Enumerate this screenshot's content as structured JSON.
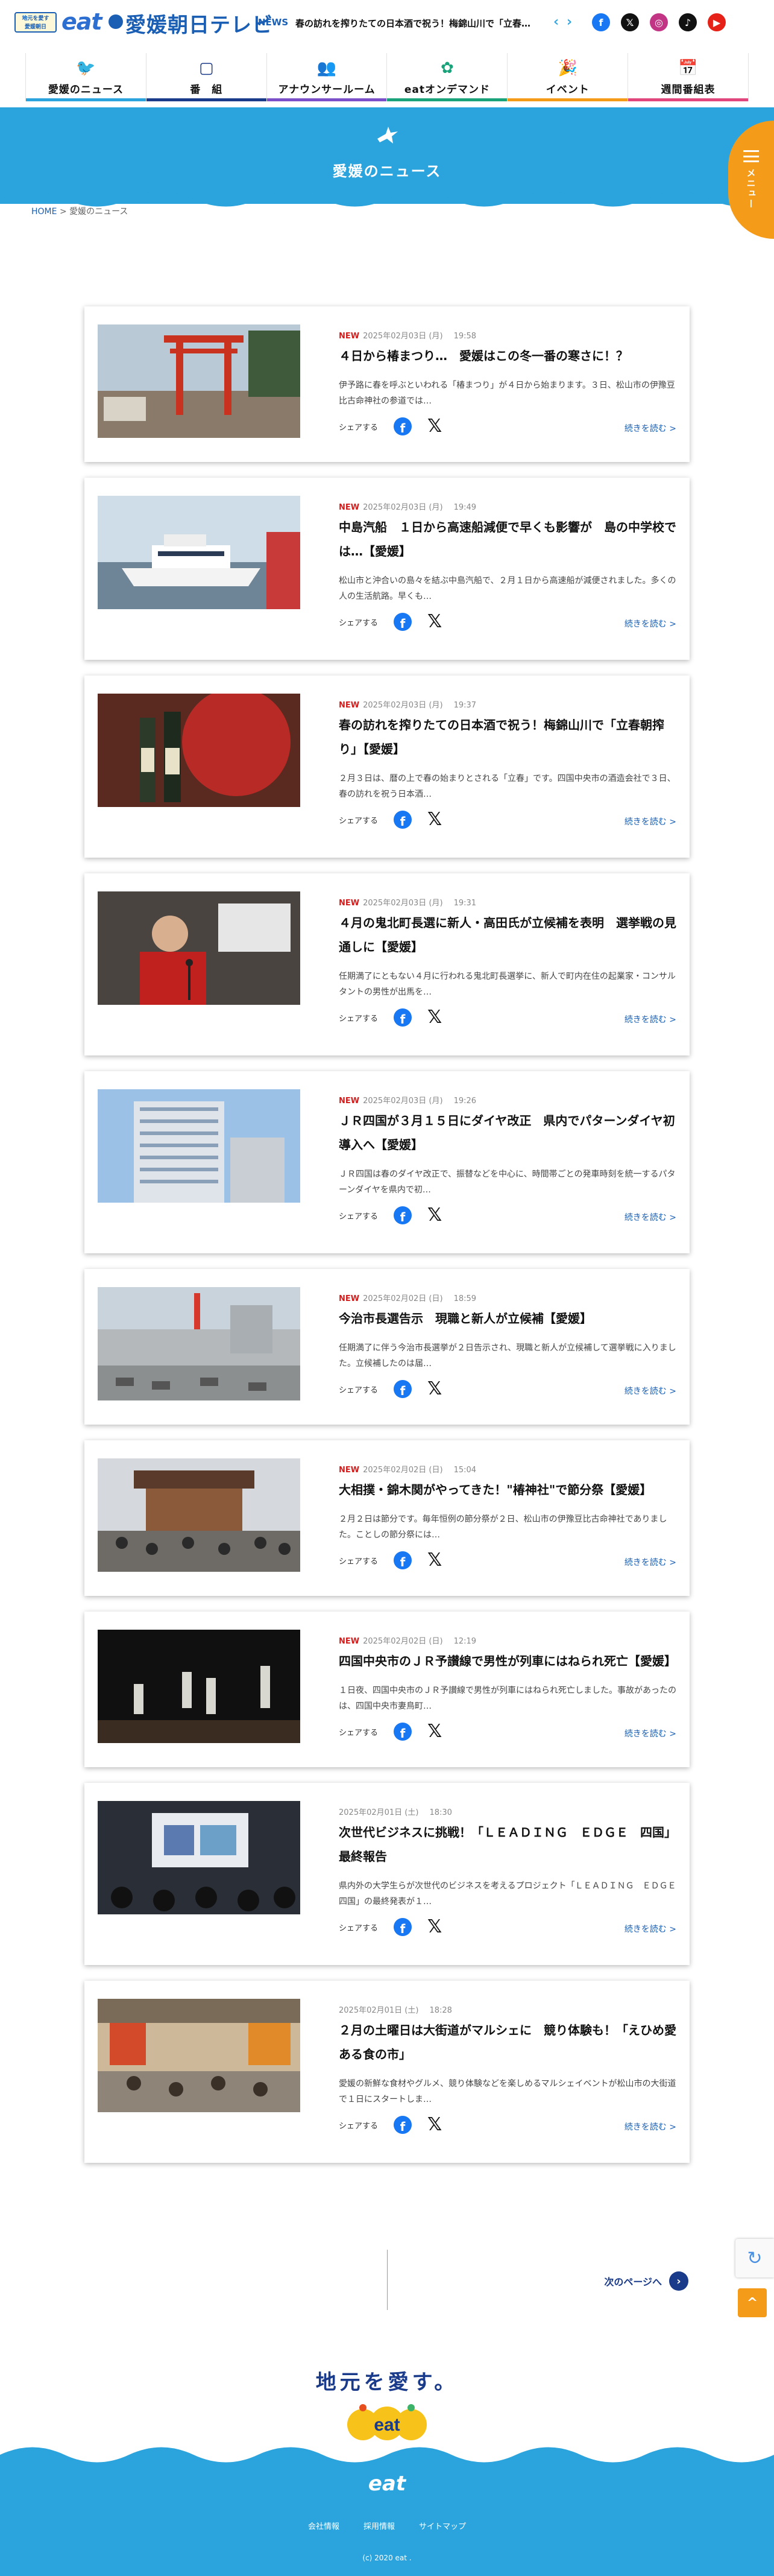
{
  "header": {
    "logo_small_lines": [
      "地元を愛す",
      "愛媛朝日"
    ],
    "logo_eat": "eat",
    "station_name": "愛媛朝日テレビ",
    "news_label": "NEWS",
    "ticker_text": "春の訪れを搾りたての日本酒で祝う！梅錦山川で「立春…",
    "ticker_prev": "‹",
    "ticker_next": "›",
    "social": [
      {
        "name": "facebook",
        "glyph": "f",
        "color": "#1877f2"
      },
      {
        "name": "x",
        "glyph": "𝕏",
        "color": "#111111"
      },
      {
        "name": "instagram",
        "glyph": "◎",
        "color": "#c13584"
      },
      {
        "name": "tiktok",
        "glyph": "♪",
        "color": "#111111"
      },
      {
        "name": "youtube",
        "glyph": "▶",
        "color": "#e62117"
      }
    ]
  },
  "nav": [
    {
      "label": "愛媛のニュース",
      "icon": "🐦",
      "color": "#2ba3dc"
    },
    {
      "label": "番　組",
      "icon": "▢",
      "color": "#1a3a8a"
    },
    {
      "label": "アナウンサールーム",
      "icon": "👥",
      "color": "#7a4fc7"
    },
    {
      "label": "eatオンデマンド",
      "icon": "✿",
      "color": "#1aa37a"
    },
    {
      "label": "イベント",
      "icon": "🎉",
      "color": "#f49b1a"
    },
    {
      "label": "週間番組表",
      "icon": "📅",
      "color": "#e0457b"
    }
  ],
  "hero": {
    "title": "愛媛のニュース",
    "menu_label": "メニュー"
  },
  "breadcrumb": {
    "home": "HOME",
    "separator": ">",
    "current": "愛媛のニュース"
  },
  "articles": [
    {
      "new": "NEW",
      "date": "2025年02月03日 (月)",
      "time": "19:58",
      "title": "４日から椿まつり…　愛媛はこの冬一番の寒さに！？",
      "excerpt": "伊予路に春を呼ぶといわれる「椿まつり」が４日から始まります。３日、松山市の伊豫豆比古命神社の参道では…",
      "scene": "shrine"
    },
    {
      "new": "NEW",
      "date": "2025年02月03日 (月)",
      "time": "19:49",
      "title": "中島汽船　１日から高速船減便で早くも影響が　島の中学校では…【愛媛】",
      "excerpt": "松山市と沖合いの島々を結ぶ中島汽船で、２月１日から高速船が減便されました。多くの人の生活航路。早くも…",
      "scene": "ship"
    },
    {
      "new": "NEW",
      "date": "2025年02月03日 (月)",
      "time": "19:37",
      "title": "春の訪れを搾りたての日本酒で祝う！梅錦山川で「立春朝搾り」【愛媛】",
      "excerpt": "２月３日は、暦の上で春の始まりとされる「立春」です。四国中央市の酒造会社で３日、春の訪れを祝う日本酒…",
      "scene": "sake"
    },
    {
      "new": "NEW",
      "date": "2025年02月03日 (月)",
      "time": "19:31",
      "title": "４月の鬼北町長選に新人・高田氏が立候補を表明　選挙戦の見通しに【愛媛】",
      "excerpt": "任期満了にともない４月に行われる鬼北町長選挙に、新人で町内在住の起業家・コンサルタントの男性が出馬を…",
      "scene": "press"
    },
    {
      "new": "NEW",
      "date": "2025年02月03日 (月)",
      "time": "19:26",
      "title": "ＪＲ四国が３月１５日にダイヤ改正　県内でパターンダイヤ初導入へ【愛媛】",
      "excerpt": "ＪＲ四国は春のダイヤ改正で、振替などを中心に、時間帯ごとの発車時刻を統一するパターンダイヤを県内で初…",
      "scene": "building"
    },
    {
      "new": "NEW",
      "date": "2025年02月02日 (日)",
      "time": "18:59",
      "title": "今治市長選告示　現職と新人が立候補【愛媛】",
      "excerpt": "任期満了に伴う今治市長選挙が２日告示され、現職と新人が立候補して選挙戦に入りました。立候補したのは届…",
      "scene": "city"
    },
    {
      "new": "NEW",
      "date": "2025年02月02日 (日)",
      "time": "15:04",
      "title": "大相撲・錦木関がやってきた！\"椿神社\"で節分祭【愛媛】",
      "excerpt": "２月２日は節分です。毎年恒例の節分祭が２日、松山市の伊豫豆比古命神社でありました。ことしの節分祭には…",
      "scene": "festival"
    },
    {
      "new": "NEW",
      "date": "2025年02月02日 (日)",
      "time": "12:19",
      "title": "四国中央市のＪＲ予讃線で男性が列車にはねられ死亡【愛媛】",
      "excerpt": "１日夜、四国中央市のＪＲ予讃線で男性が列車にはねられ死亡しました。事故があったのは、四国中央市妻鳥町…",
      "scene": "night"
    },
    {
      "new": "",
      "date": "2025年02月01日 (土)",
      "time": "18:30",
      "title": "次世代ビジネスに挑戦！「ＬＥＡＤＩＮＧ　ＥＤＧＥ　四国」最終報告",
      "excerpt": "県内外の大学生らが次世代のビジネスを考えるプロジェクト「ＬＥＡＤＩＮＧ　ＥＤＧＥ四国」の最終発表が１…",
      "scene": "seminar"
    },
    {
      "new": "",
      "date": "2025年02月01日 (土)",
      "time": "18:28",
      "title": "２月の土曜日は大街道がマルシェに　競り体験も！「えひめ愛ある食の市」",
      "excerpt": "愛媛の新鮮な食材やグルメ、競り体験などを楽しめるマルシェイベントが松山市の大街道で１日にスタートしま…",
      "scene": "market"
    }
  ],
  "article_ui": {
    "share_label": "シェアする",
    "facebook_glyph": "f",
    "x_glyph": "𝕏",
    "more_label": "続きを読む >"
  },
  "pagination": {
    "next_label": "次のページへ",
    "next_glyph": "›"
  },
  "recaptcha_glyph": "↻",
  "pagetop_glyph": "^",
  "footer": {
    "slogan": "地元を愛す。",
    "mascot_text": "eat",
    "logo": "eat",
    "links": [
      "会社情報",
      "採用情報",
      "サイトマップ"
    ],
    "copyright": "(c) 2020 eat ."
  }
}
